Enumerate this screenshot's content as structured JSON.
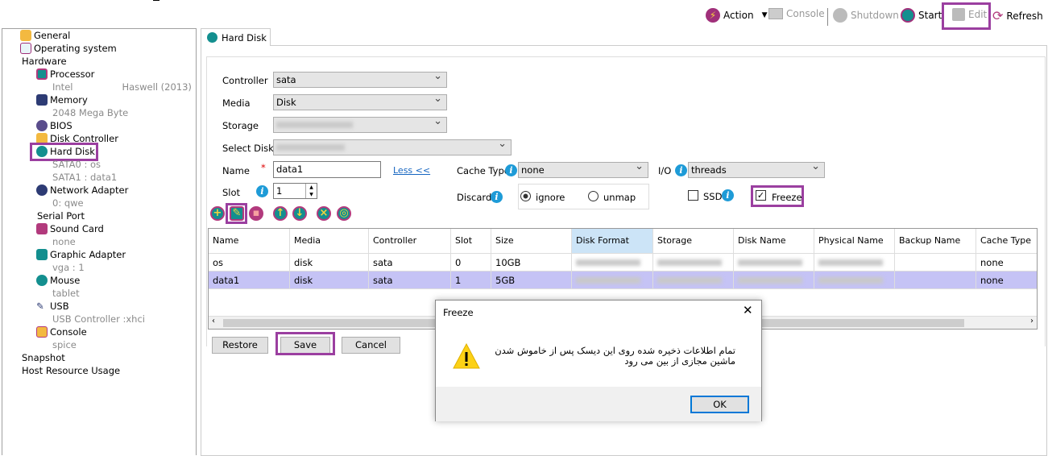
{
  "toolbar": {
    "action": "Action",
    "console": "Console",
    "shutdown": "Shutdown",
    "start": "Start",
    "edit": "Edit",
    "refresh": "Refresh"
  },
  "tree": {
    "general": "General",
    "os": "Operating system",
    "hardware": "Hardware",
    "processor": "Processor",
    "proc_sub": "Intel",
    "proc_gen": "Haswell (2013)",
    "memory": "Memory",
    "mem_sub": "2048 Mega Byte",
    "bios": "BIOS",
    "disk_controller": "Disk Controller",
    "hard_disk": "Hard Disk",
    "sata0": "SATA0 : os",
    "sata1": "SATA1 : data1",
    "network": "Network Adapter",
    "net_sub": "0: qwe",
    "serial": "Serial Port",
    "sound": "Sound Card",
    "sound_sub": "none",
    "graphic": "Graphic Adapter",
    "graphic_sub": "vga : 1",
    "mouse": "Mouse",
    "mouse_sub": "tablet",
    "usb": "USB",
    "usb_sub": "USB Controller :xhci",
    "console": "Console",
    "console_sub": "spice",
    "snapshot": "Snapshot",
    "host": "Host Resource Usage"
  },
  "tab": "Hard Disk",
  "form": {
    "controller_label": "Controller",
    "controller": "sata",
    "media_label": "Media",
    "media": "Disk",
    "storage_label": "Storage",
    "select_disk_label": "Select Disk",
    "name_label": "Name",
    "required": "*",
    "name": "data1",
    "less": "Less <<",
    "slot_label": "Slot",
    "slot": "1",
    "cache_label": "Cache Type",
    "cache": "none",
    "io_label": "I/O",
    "io": "threads",
    "discard_label": "Discard",
    "ignore": "ignore",
    "unmap": "unmap",
    "ssd": "SSD",
    "freeze": "Freeze",
    "info": "i"
  },
  "table": {
    "headers": [
      "Name",
      "Media",
      "Controller",
      "Slot",
      "Size",
      "Disk Format",
      "Storage",
      "Disk Name",
      "Physical Name",
      "Backup Name",
      "Cache Type"
    ],
    "rows": [
      [
        "os",
        "disk",
        "sata",
        "0",
        "10GB",
        "",
        "",
        "",
        "",
        "",
        "none"
      ],
      [
        "data1",
        "disk",
        "sata",
        "1",
        "5GB",
        "",
        "",
        "",
        "",
        "",
        "none"
      ]
    ]
  },
  "buttons": {
    "restore": "Restore",
    "save": "Save",
    "cancel": "Cancel"
  },
  "dialog": {
    "title": "Freeze",
    "message": "تمام اطلاعات ذخیره شده روی این دیسک پس از خاموش شدن ماشین مجازی از بین می رود",
    "ok": "OK",
    "close": "✕"
  },
  "colors": {
    "highlight": "#9b3fa0",
    "selected_row": "#c5c3f5",
    "accent": "#138f8f"
  }
}
